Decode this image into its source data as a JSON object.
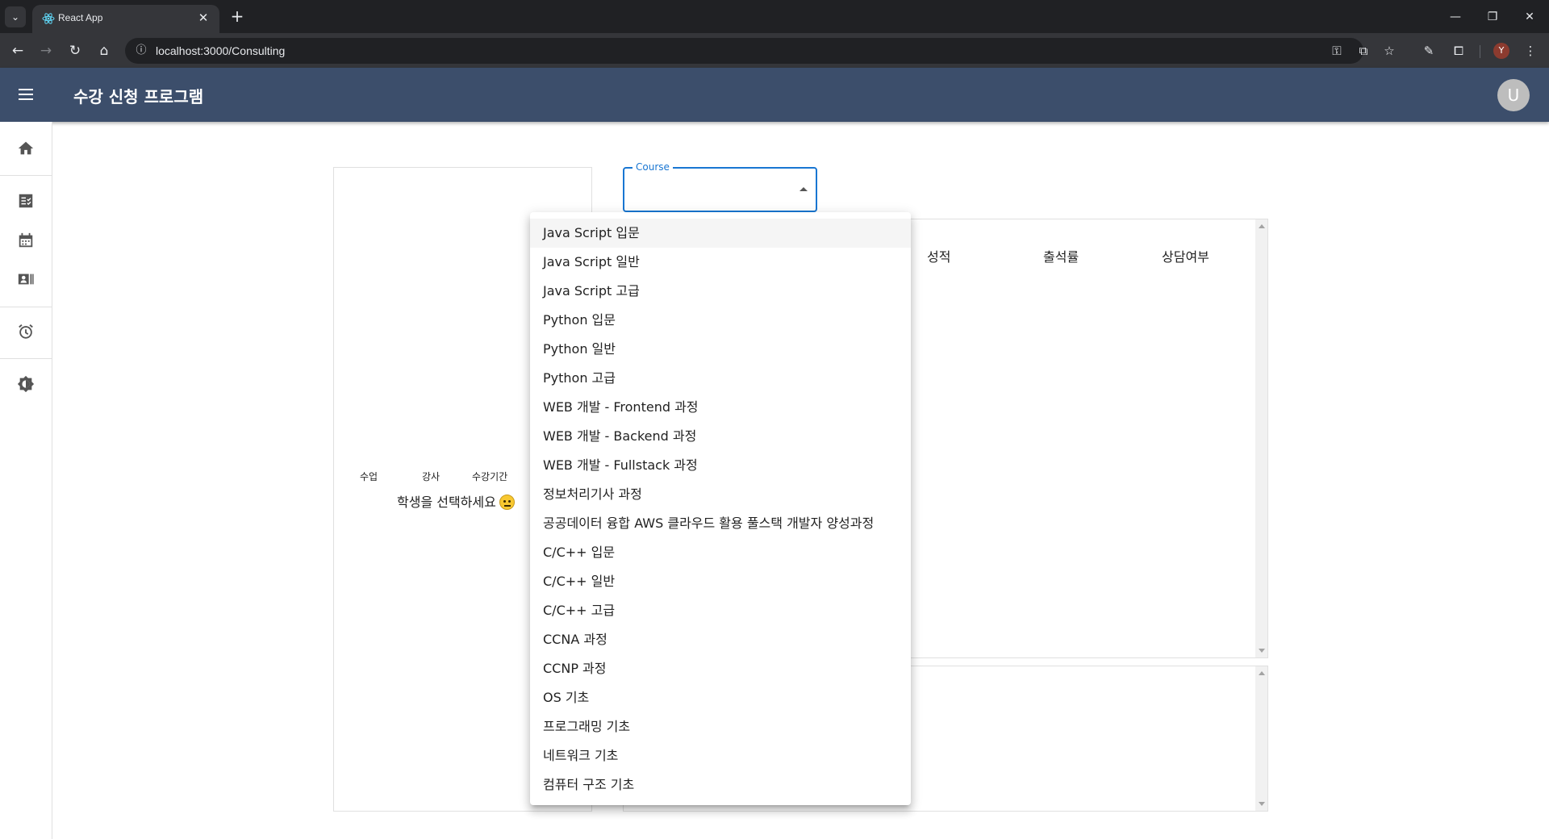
{
  "browser": {
    "tab_title": "React App",
    "url": "localhost:3000/Consulting",
    "profile_initial": "Y"
  },
  "app": {
    "title": "수강 신청 프로그램",
    "avatar_initial": "U"
  },
  "left_panel": {
    "columns": [
      "수업",
      "강사",
      "수강기간"
    ],
    "prompt": "학생을 선택하세요"
  },
  "course_select": {
    "label": "Course",
    "value": ""
  },
  "table": {
    "headers": [
      "성적",
      "출석률",
      "상담여부"
    ]
  },
  "dropdown": {
    "options": [
      "Java Script 입문",
      "Java Script 일반",
      "Java Script 고급",
      "Python 입문",
      "Python 일반",
      "Python 고급",
      "WEB 개발 - Frontend 과정",
      "WEB 개발 - Backend 과정",
      "WEB 개발 - Fullstack 과정",
      "정보처리기사 과정",
      "공공데이터 융합 AWS 클라우드 활용 풀스택 개발자 양성과정",
      "C/C++ 입문",
      "C/C++ 일반",
      "C/C++ 고급",
      "CCNA 과정",
      "CCNP 과정",
      "OS 기초",
      "프로그래밍 기초",
      "네트워크 기초",
      "컴퓨터 구조 기초"
    ]
  },
  "colors": {
    "appbar": "#3c4e6b",
    "accent": "#1976d2"
  },
  "drawer_icons": [
    "home-icon",
    "checklist-icon",
    "calendar-icon",
    "contact-card-icon",
    "alarm-icon",
    "brightness-icon"
  ]
}
